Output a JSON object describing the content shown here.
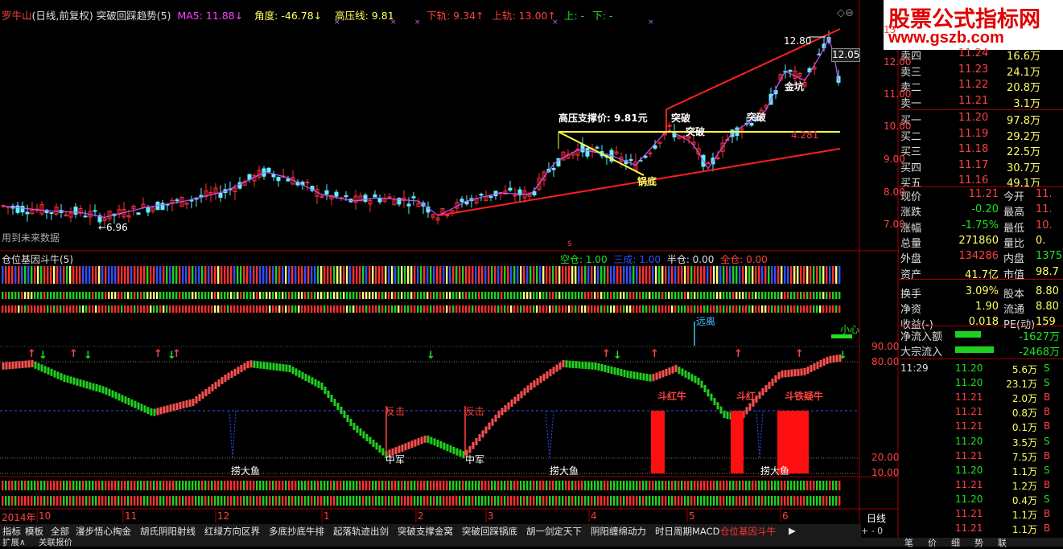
{
  "header": {
    "stock": "罗牛山",
    "period": "(日线,前复权)",
    "indicator": "突破回踩趋势(5)",
    "ma5": "MA5: 11.88",
    "ma5_arrow": "↓",
    "angle": "角度: -46.78",
    "angle_arrow": "↓",
    "high_line": "高压线: 9.81",
    "lower_track": "下轨: 9.34",
    "lower_arrow": "↑",
    "upper_track": "上轨: 13.00",
    "upper_arrow": "↑",
    "up_label": "上: -",
    "down_label": "下: -"
  },
  "price_axis": [
    "13",
    "12.00",
    "11.00",
    "10.00",
    "9.00",
    "8.00",
    "7.00"
  ],
  "current_price_tag": "12.05",
  "chart_labels": {
    "high_12_80": "12.80",
    "low_6_96": "←6.96",
    "support_text": "高压支撑价: 9.81元",
    "break1": "突破",
    "break2": "突破",
    "break3": "突破",
    "jinkeng": "金坑",
    "pot_bottom": "锅底",
    "val_4281": "4.281",
    "future_data": "用到未来数据",
    "s_marker": "S"
  },
  "panel2": {
    "title": "仓位基因斗牛(5)",
    "kongcang": "空仓: 1.00",
    "sancheng": "三成: 1.00",
    "bancang": "半仓: 0.00",
    "quancang": "全仓: 0.00"
  },
  "panel3": {
    "yuanli": "远离",
    "xiaoxin": "小心",
    "fanji1": "反击",
    "fanji2": "反击",
    "zhongjun1": "中军",
    "zhongjun2": "中军",
    "laodayu1": "捞大鱼",
    "laodayu2": "捞大鱼",
    "laodayu3": "捞大鱼",
    "douhongniu1": "斗红牛",
    "douhongniu2": "斗红",
    "doutieniu": "斗铁疑牛",
    "axis": [
      "90.00",
      "80.00",
      "20.00",
      "10.00"
    ]
  },
  "date_axis": [
    "2014年",
    "10",
    "11",
    "12",
    "1",
    "2",
    "3",
    "4",
    "5",
    "6"
  ],
  "tabs": [
    "指标",
    "模板",
    "全部",
    "漫步悟心掏金",
    "胡氏阴阳射线",
    "红绿方向区界",
    "多底抄底牛排",
    "起落轨迹出剑",
    "突破支撑金窝",
    "突破回踩锅底",
    "胡一剑定天下",
    "阴阳缠绵动力",
    "时日周期MACD",
    "仓位基因斗牛"
  ],
  "bottom_bar": [
    "扩展∧",
    "关联报价"
  ],
  "period_btn": "日线",
  "brand": {
    "title": "股票公式指标网",
    "url": "www.gszb.com"
  },
  "order_book": [
    {
      "label": "卖四",
      "price": "11.24",
      "vol": "16.6万"
    },
    {
      "label": "卖三",
      "price": "11.23",
      "vol": "24.1万"
    },
    {
      "label": "卖二",
      "price": "11.22",
      "vol": "20.8万"
    },
    {
      "label": "卖一",
      "price": "11.21",
      "vol": "3.1万"
    },
    {
      "label": "买一",
      "price": "11.20",
      "vol": "97.8万"
    },
    {
      "label": "买二",
      "price": "11.19",
      "vol": "29.2万"
    },
    {
      "label": "买三",
      "price": "11.18",
      "vol": "22.5万"
    },
    {
      "label": "买四",
      "price": "11.17",
      "vol": "30.7万"
    },
    {
      "label": "买五",
      "price": "11.16",
      "vol": "49.1万"
    }
  ],
  "stats": [
    {
      "l1": "现价",
      "v1": "11.21",
      "l2": "今开",
      "v2": "11."
    },
    {
      "l1": "涨跌",
      "v1": "-0.20",
      "l2": "最高",
      "v2": "11."
    },
    {
      "l1": "涨幅",
      "v1": "-1.75%",
      "l2": "最低",
      "v2": "10."
    },
    {
      "l1": "总量",
      "v1": "271860",
      "l2": "量比",
      "v2": "0."
    },
    {
      "l1": "外盘",
      "v1": "134286",
      "l2": "内盘",
      "v2": "1375"
    },
    {
      "l1": "资产",
      "v1": "41.7亿",
      "l2": "市值",
      "v2": "98.7"
    },
    {
      "l1": "换手",
      "v1": "3.09%",
      "l2": "股本",
      "v2": "8.80"
    },
    {
      "l1": "净资",
      "v1": "1.90",
      "l2": "流通",
      "v2": "8.80"
    },
    {
      "l1": "收益(-)",
      "v1": "0.018",
      "l2": "PE(动)",
      "v2": "159"
    }
  ],
  "flows": [
    {
      "label": "净流入额",
      "value": "-1627万"
    },
    {
      "label": "大宗流入",
      "value": "-2468万"
    }
  ],
  "ticks": [
    {
      "time": "11:29",
      "price": "11.20",
      "vol": "5.6万",
      "side": "S"
    },
    {
      "time": "",
      "price": "11.20",
      "vol": "23.1万",
      "side": "S"
    },
    {
      "time": "",
      "price": "11.21",
      "vol": "2.0万",
      "side": "B"
    },
    {
      "time": "",
      "price": "11.21",
      "vol": "0.8万",
      "side": "B"
    },
    {
      "time": "",
      "price": "11.21",
      "vol": "0.1万",
      "side": "B"
    },
    {
      "time": "",
      "price": "11.20",
      "vol": "3.5万",
      "side": "S"
    },
    {
      "time": "",
      "price": "11.21",
      "vol": "7.5万",
      "side": "B"
    },
    {
      "time": "",
      "price": "11.20",
      "vol": "1.1万",
      "side": "S"
    },
    {
      "time": "",
      "price": "11.21",
      "vol": "1.2万",
      "side": "B"
    },
    {
      "time": "",
      "price": "11.20",
      "vol": "0.4万",
      "side": "S"
    },
    {
      "time": "",
      "price": "11.21",
      "vol": "1.1万",
      "side": "B"
    },
    {
      "time": "",
      "price": "11.21",
      "vol": "1.1万",
      "side": "B"
    }
  ],
  "bottom_right": [
    "笔",
    "价",
    "细",
    "势",
    "联"
  ],
  "colors": {
    "up": "#ff3030",
    "down": "#00d000",
    "accent": "#ffff00",
    "cyan": "#00ffff"
  }
}
